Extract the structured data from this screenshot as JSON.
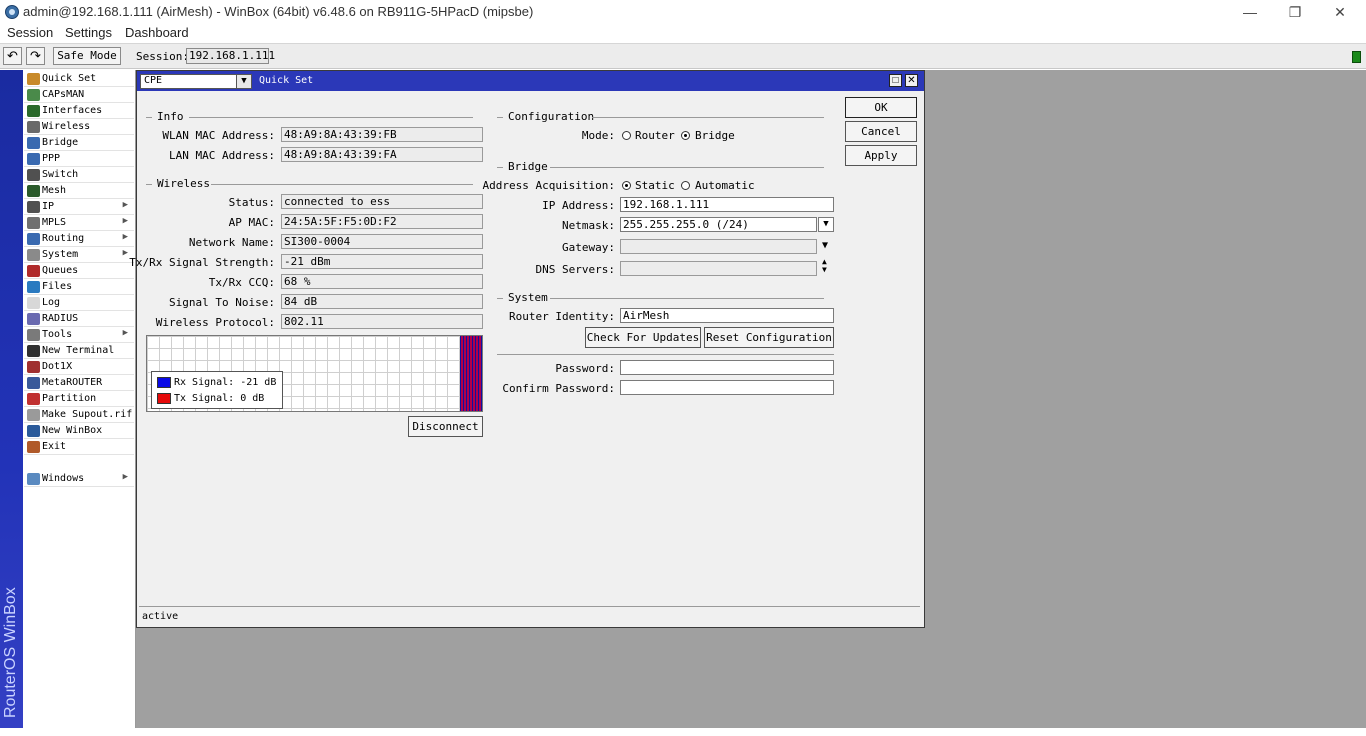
{
  "window": {
    "title": "admin@192.168.1.111 (AirMesh) - WinBox (64bit) v6.48.6 on RB911G-5HPacD (mipsbe)",
    "minimize": "—",
    "restore": "❐",
    "close": "✕"
  },
  "menu": [
    "Session",
    "Settings",
    "Dashboard"
  ],
  "toolbar": {
    "undo": "↶",
    "redo": "↷",
    "safe_mode": "Safe Mode",
    "session_label": "Session:",
    "session_value": "192.168.1.111"
  },
  "brand": "RouterOS WinBox",
  "sidebar": [
    {
      "label": "Quick Set",
      "icon": "wand-icon",
      "color": "#c88a2a",
      "arrow": ""
    },
    {
      "label": "CAPsMAN",
      "icon": "antenna-icon",
      "color": "#4a8a4a",
      "arrow": ""
    },
    {
      "label": "Interfaces",
      "icon": "nic-icon",
      "color": "#2a6a2a",
      "arrow": ""
    },
    {
      "label": "Wireless",
      "icon": "wireless-icon",
      "color": "#6a6a6a",
      "arrow": ""
    },
    {
      "label": "Bridge",
      "icon": "bridge-icon",
      "color": "#3a6ab0",
      "arrow": ""
    },
    {
      "label": "PPP",
      "icon": "ppp-icon",
      "color": "#3a6ab0",
      "arrow": ""
    },
    {
      "label": "Switch",
      "icon": "switch-icon",
      "color": "#505050",
      "arrow": ""
    },
    {
      "label": "Mesh",
      "icon": "mesh-icon",
      "color": "#2a5a2a",
      "arrow": ""
    },
    {
      "label": "IP",
      "icon": "ip-icon",
      "color": "#505050",
      "arrow": "▶"
    },
    {
      "label": "MPLS",
      "icon": "mpls-icon",
      "color": "#707070",
      "arrow": "▶"
    },
    {
      "label": "Routing",
      "icon": "routing-icon",
      "color": "#3a6ab0",
      "arrow": "▶"
    },
    {
      "label": "System",
      "icon": "gear-icon",
      "color": "#8a8a8a",
      "arrow": "▶"
    },
    {
      "label": "Queues",
      "icon": "queues-icon",
      "color": "#b02a2a",
      "arrow": ""
    },
    {
      "label": "Files",
      "icon": "folder-icon",
      "color": "#2a7ac0",
      "arrow": ""
    },
    {
      "label": "Log",
      "icon": "log-icon",
      "color": "#d8d8d8",
      "arrow": ""
    },
    {
      "label": "RADIUS",
      "icon": "radius-icon",
      "color": "#6a6ab0",
      "arrow": ""
    },
    {
      "label": "Tools",
      "icon": "tools-icon",
      "color": "#7a7a7a",
      "arrow": "▶"
    },
    {
      "label": "New Terminal",
      "icon": "terminal-icon",
      "color": "#303030",
      "arrow": ""
    },
    {
      "label": "Dot1X",
      "icon": "dot1x-icon",
      "color": "#a03030",
      "arrow": ""
    },
    {
      "label": "MetaROUTER",
      "icon": "metarouter-icon",
      "color": "#3a5a9a",
      "arrow": ""
    },
    {
      "label": "Partition",
      "icon": "partition-icon",
      "color": "#c03030",
      "arrow": ""
    },
    {
      "label": "Make Supout.rif",
      "icon": "supout-icon",
      "color": "#9a9a9a",
      "arrow": ""
    },
    {
      "label": "New WinBox",
      "icon": "winbox-icon",
      "color": "#2a5a9a",
      "arrow": ""
    },
    {
      "label": "Exit",
      "icon": "exit-icon",
      "color": "#b05a2a",
      "arrow": ""
    }
  ],
  "sidebar_windows": {
    "label": "Windows",
    "icon": "windows-icon",
    "color": "#5a8ac0",
    "arrow": "▶"
  },
  "dialog": {
    "mode_select": "CPE",
    "mode_select_arrow": "▼",
    "title": "Quick Set",
    "ctl_max": "□",
    "ctl_close": "✕",
    "info": {
      "header": "Info",
      "wlan_mac_label": "WLAN MAC Address:",
      "wlan_mac": "48:A9:8A:43:39:FB",
      "lan_mac_label": "LAN MAC Address:",
      "lan_mac": "48:A9:8A:43:39:FA"
    },
    "wireless": {
      "header": "Wireless",
      "rows": [
        {
          "label": "Status:",
          "value": "connected to ess"
        },
        {
          "label": "AP MAC:",
          "value": "24:5A:5F:F5:0D:F2"
        },
        {
          "label": "Network Name:",
          "value": "SI300-0004"
        },
        {
          "label": "Tx/Rx Signal Strength:",
          "value": "-21 dBm"
        },
        {
          "label": "Tx/Rx CCQ:",
          "value": "68 %"
        },
        {
          "label": "Signal To Noise:",
          "value": "84 dB"
        },
        {
          "label": "Wireless Protocol:",
          "value": "802.11"
        }
      ],
      "legend_rx": "Rx Signal:  -21 dB",
      "legend_tx": "Tx Signal:  0 dB",
      "rx_color": "#0a0ae6",
      "tx_color": "#e60a0a",
      "disconnect": "Disconnect"
    },
    "configuration": {
      "header": "Configuration",
      "mode_label": "Mode:",
      "router": "Router",
      "bridge": "Bridge",
      "selected": "Bridge"
    },
    "bridge": {
      "header": "Bridge",
      "acq_label": "Address Acquisition:",
      "static": "Static",
      "automatic": "Automatic",
      "selected": "Static",
      "ip_label": "IP Address:",
      "ip": "192.168.1.111",
      "netmask_label": "Netmask:",
      "netmask": "255.255.255.0 (/24)",
      "gateway_label": "Gateway:",
      "gateway": "",
      "dns_label": "DNS Servers:",
      "dns": ""
    },
    "system": {
      "header": "System",
      "identity_label": "Router Identity:",
      "identity": "AirMesh",
      "check_updates": "Check For Updates",
      "reset_config": "Reset Configuration",
      "password_label": "Password:",
      "password": "",
      "confirm_label": "Confirm Password:",
      "confirm": ""
    },
    "buttons": {
      "ok": "OK",
      "cancel": "Cancel",
      "apply": "Apply"
    },
    "status": "active"
  },
  "colors": {
    "accent": "#2b38b8",
    "desktop": "#a0a0a0"
  }
}
